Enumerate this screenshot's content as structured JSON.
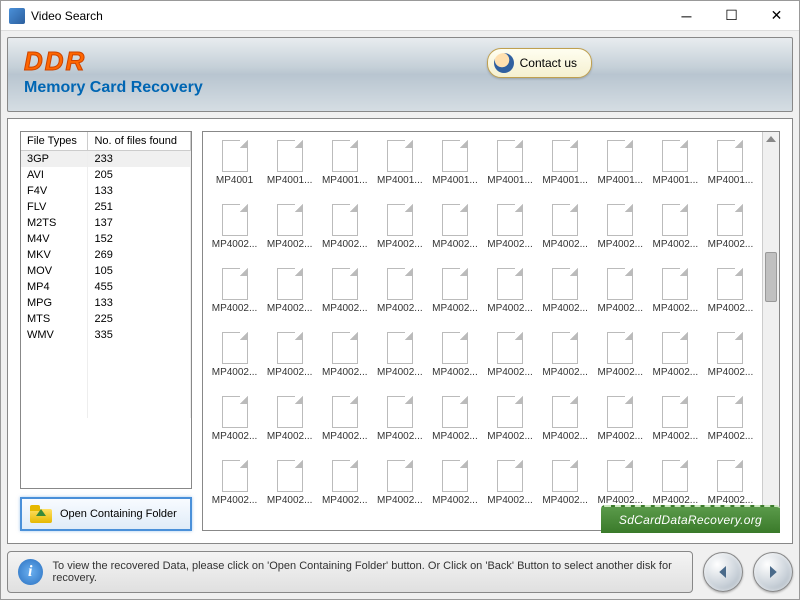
{
  "window": {
    "title": "Video Search"
  },
  "header": {
    "logo": "DDR",
    "subtitle": "Memory Card Recovery",
    "contact_label": "Contact us"
  },
  "table": {
    "col1": "File Types",
    "col2": "No. of files found",
    "rows": [
      {
        "type": "3GP",
        "count": "233"
      },
      {
        "type": "AVI",
        "count": "205"
      },
      {
        "type": "F4V",
        "count": "133"
      },
      {
        "type": "FLV",
        "count": "251"
      },
      {
        "type": "M2TS",
        "count": "137"
      },
      {
        "type": "M4V",
        "count": "152"
      },
      {
        "type": "MKV",
        "count": "269"
      },
      {
        "type": "MOV",
        "count": "105"
      },
      {
        "type": "MP4",
        "count": "455"
      },
      {
        "type": "MPG",
        "count": "133"
      },
      {
        "type": "MTS",
        "count": "225"
      },
      {
        "type": "WMV",
        "count": "335"
      }
    ]
  },
  "open_folder_label": "Open Containing Folder",
  "files": {
    "prefix_first": "MP4001",
    "prefix_most": "MP4001...",
    "prefix_rest": "MP4002...",
    "count": 60
  },
  "brand": "SdCardDataRecovery.org",
  "footer": {
    "info": "To view the recovered Data, please click on 'Open Containing Folder' button. Or Click on 'Back' Button to select another disk for recovery."
  }
}
